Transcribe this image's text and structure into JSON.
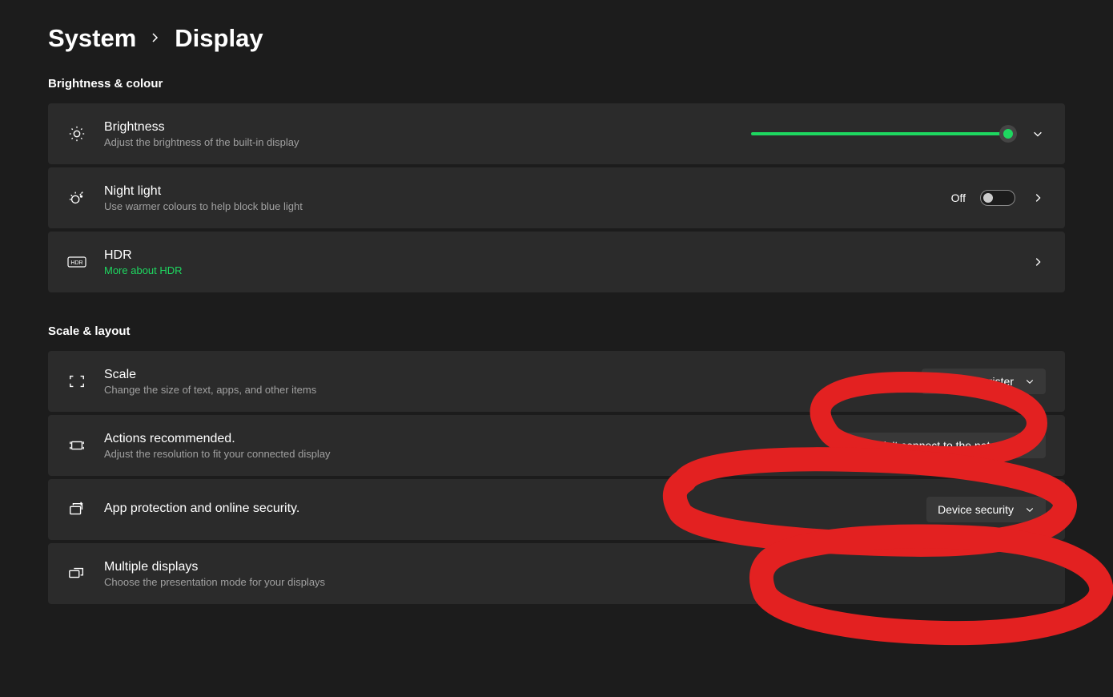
{
  "breadcrumb": {
    "parent": "System",
    "current": "Display"
  },
  "sections": {
    "brightness": {
      "header": "Brightness & colour",
      "brightness_card": {
        "title": "Brightness",
        "subtitle": "Adjust the brightness of the built-in display",
        "slider_value": 100
      },
      "night_light_card": {
        "title": "Night light",
        "subtitle": "Use warmer colours to help block blue light",
        "toggle_label": "Off",
        "toggle_state": false
      },
      "hdr_card": {
        "title": "HDR",
        "subtitle": "More about HDR"
      }
    },
    "scale": {
      "header": "Scale & layout",
      "scale_card": {
        "title": "Scale",
        "subtitle": "Change the size of text, apps, and other items",
        "dropdown_value": "Couldn't register"
      },
      "resolution_card": {
        "title": "Actions recommended.",
        "subtitle": "Adjust the resolution to fit your connected display",
        "dropdown_value": "We couldn't connect to the network"
      },
      "security_card": {
        "title": "App protection and online security.",
        "dropdown_value": "Device security"
      },
      "multiple_displays_card": {
        "title": "Multiple displays",
        "subtitle": "Choose the presentation mode for your displays"
      }
    }
  },
  "annotations": {
    "color": "#e32121"
  }
}
